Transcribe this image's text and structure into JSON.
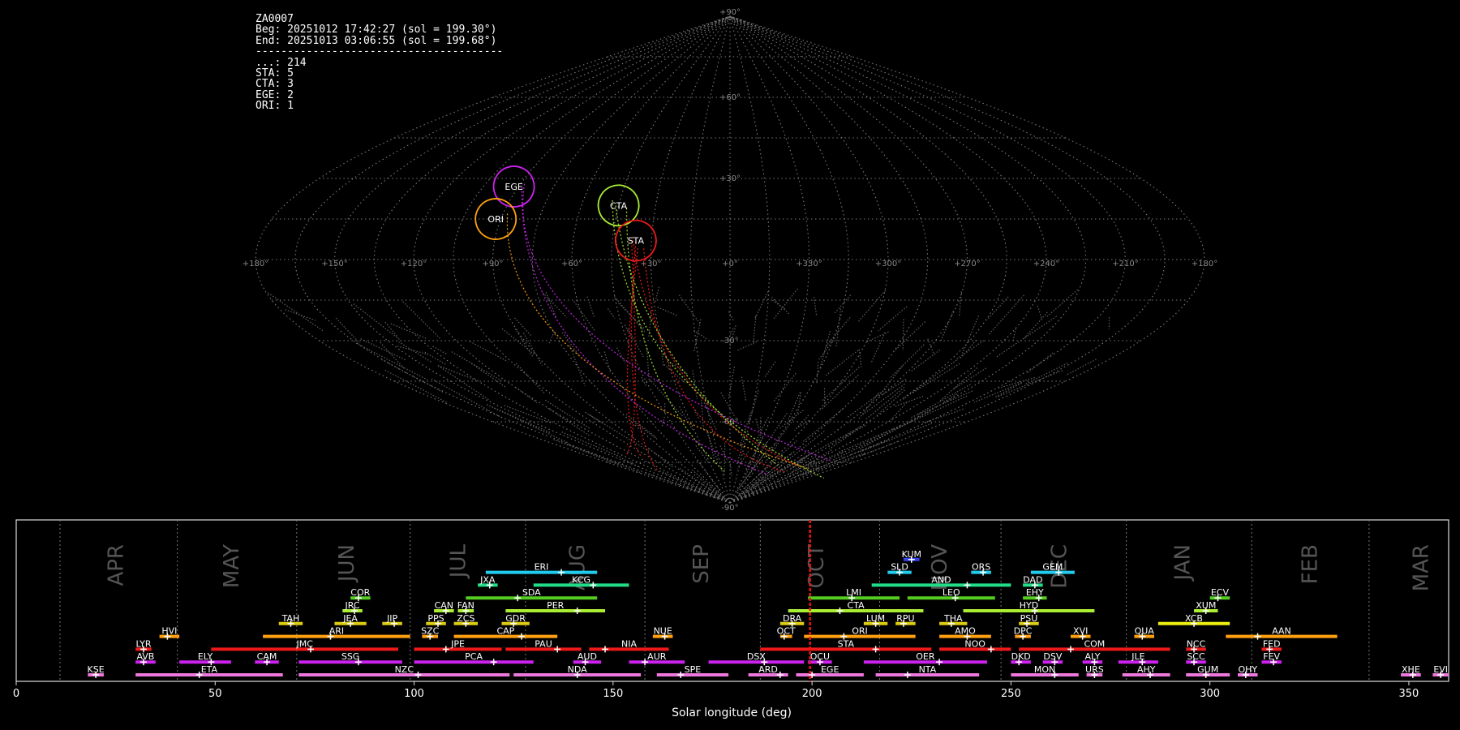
{
  "header": {
    "lines": [
      "ZA0007",
      "Beg: 20251012 17:42:27 (sol = 199.30°)",
      "End: 20251013 03:06:55 (sol = 199.68°)",
      "---------------------------------------",
      "...: 214",
      "STA: 5",
      "CTA: 3",
      "EGE: 2",
      "ORI: 1"
    ]
  },
  "chart_data": [
    {
      "type": "scatter",
      "title": "",
      "projection": "sinusoidal",
      "lon_ticks": [
        180,
        150,
        120,
        90,
        60,
        30,
        0,
        330,
        300,
        270,
        240,
        210,
        180
      ],
      "lon_tick_labels": [
        "+180°",
        "+150°",
        "+120°",
        "+90°",
        "+60°",
        "+30°",
        "+0°",
        "+330°",
        "+300°",
        "+270°",
        "+240°",
        "+210°",
        "+180°"
      ],
      "lat_ticks": [
        90,
        60,
        30,
        0,
        -30,
        -60,
        -90
      ],
      "lat_tick_labels": [
        "+90°",
        "+60°",
        "+30°",
        "",
        "-30°",
        "-60°",
        "-90°"
      ],
      "grid": true,
      "radiants": [
        {
          "code": "EGE",
          "lon": 92,
          "lat": 27,
          "color": "#cc22ee"
        },
        {
          "code": "ORI",
          "lon": 92,
          "lat": 15,
          "color": "#ffa010"
        },
        {
          "code": "CTA",
          "lon": 45,
          "lat": 20,
          "color": "#aaee33"
        },
        {
          "code": "STA",
          "lon": 36,
          "lat": 7,
          "color": "#ee1a1a"
        }
      ],
      "counts": [
        {
          "code": "...",
          "count": 214,
          "color": "#888888"
        },
        {
          "code": "STA",
          "count": 5,
          "color": "#ee1a1a"
        },
        {
          "code": "CTA",
          "count": 3,
          "color": "#aaee33"
        },
        {
          "code": "EGE",
          "count": 2,
          "color": "#cc22ee"
        },
        {
          "code": "ORI",
          "count": 1,
          "color": "#ffa010"
        }
      ]
    },
    {
      "type": "bar",
      "title": "",
      "xlabel": "Solar longitude (deg)",
      "xlim": [
        0,
        360
      ],
      "x_ticks": [
        0,
        50,
        100,
        150,
        200,
        250,
        300,
        350
      ],
      "current_sol": 199.5,
      "months": [
        {
          "name": "APR",
          "start": 11,
          "label_at": 25
        },
        {
          "name": "MAY",
          "start": 40.5,
          "label_at": 54
        },
        {
          "name": "JUN",
          "start": 70.5,
          "label_at": 83
        },
        {
          "name": "JUL",
          "start": 99,
          "label_at": 111
        },
        {
          "name": "AUG",
          "start": 128,
          "label_at": 141
        },
        {
          "name": "SEP",
          "start": 158,
          "label_at": 172
        },
        {
          "name": "OCT",
          "start": 187,
          "label_at": 201
        },
        {
          "name": "NOV",
          "start": 217,
          "label_at": 232
        },
        {
          "name": "DEC",
          "start": 247.5,
          "label_at": 262
        },
        {
          "name": "JAN",
          "start": 279,
          "label_at": 293
        },
        {
          "name": "FEB",
          "start": 310.5,
          "label_at": 325
        },
        {
          "name": "MAR",
          "start": 340,
          "label_at": 353
        }
      ],
      "showers": [
        {
          "code": "KUM",
          "row": 9,
          "start": 223,
          "end": 227,
          "peak": 225,
          "color": "#3344ee"
        },
        {
          "code": "ERI",
          "row": 8,
          "start": 118,
          "end": 146,
          "peak": 137,
          "color": "#22ccee"
        },
        {
          "code": "SLD",
          "row": 8,
          "start": 219,
          "end": 225,
          "peak": 222,
          "color": "#22ccee"
        },
        {
          "code": "ORS",
          "row": 8,
          "start": 240,
          "end": 245,
          "peak": 243,
          "color": "#22ccee"
        },
        {
          "code": "GEM",
          "row": 8,
          "start": 255,
          "end": 266,
          "peak": 262,
          "color": "#22ccee"
        },
        {
          "code": "JXA",
          "row": 7,
          "start": 116,
          "end": 121,
          "peak": 119,
          "color": "#22dd88"
        },
        {
          "code": "KCG",
          "row": 7,
          "start": 130,
          "end": 154,
          "peak": 145,
          "color": "#22dd88"
        },
        {
          "code": "AND",
          "row": 7,
          "start": 215,
          "end": 250,
          "peak": 239,
          "color": "#22dd88"
        },
        {
          "code": "DAD",
          "row": 7,
          "start": 253,
          "end": 258,
          "peak": 256,
          "color": "#22dd88"
        },
        {
          "code": "COR",
          "row": 6,
          "start": 84,
          "end": 89,
          "peak": 86,
          "color": "#55cc22"
        },
        {
          "code": "SDA",
          "row": 6,
          "start": 113,
          "end": 146,
          "peak": 126,
          "color": "#55cc22"
        },
        {
          "code": "LMI",
          "row": 6,
          "start": 199,
          "end": 222,
          "peak": 210,
          "color": "#55cc22"
        },
        {
          "code": "LEO",
          "row": 6,
          "start": 224,
          "end": 246,
          "peak": 236,
          "color": "#55cc22"
        },
        {
          "code": "EHY",
          "row": 6,
          "start": 253,
          "end": 259,
          "peak": 257,
          "color": "#55cc22"
        },
        {
          "code": "ECV",
          "row": 6,
          "start": 300,
          "end": 305,
          "peak": 302,
          "color": "#55cc22"
        },
        {
          "code": "JRC",
          "row": 5,
          "start": 82,
          "end": 87,
          "peak": 85,
          "color": "#aaee33"
        },
        {
          "code": "CAN",
          "row": 5,
          "start": 105,
          "end": 110,
          "peak": 108,
          "color": "#aaee33"
        },
        {
          "code": "FAN",
          "row": 5,
          "start": 111,
          "end": 115,
          "peak": 113,
          "color": "#aaee33"
        },
        {
          "code": "PER",
          "row": 5,
          "start": 123,
          "end": 148,
          "peak": 141,
          "color": "#aaee33"
        },
        {
          "code": "CTA",
          "row": 5,
          "start": 194,
          "end": 228,
          "peak": 207,
          "color": "#aaee33"
        },
        {
          "code": "HYD",
          "row": 5,
          "start": 238,
          "end": 271,
          "peak": 256,
          "color": "#aaee33"
        },
        {
          "code": "XUM",
          "row": 5,
          "start": 296,
          "end": 302,
          "peak": 299,
          "color": "#aaee33"
        },
        {
          "code": "TAH",
          "row": 4,
          "start": 66,
          "end": 72,
          "peak": 69,
          "color": "#ddcc11"
        },
        {
          "code": "JEA",
          "row": 4,
          "start": 80,
          "end": 88,
          "peak": 84,
          "color": "#ddcc11"
        },
        {
          "code": "JIP",
          "row": 4,
          "start": 92,
          "end": 97,
          "peak": 95,
          "color": "#ddcc11"
        },
        {
          "code": "PPS",
          "row": 4,
          "start": 103,
          "end": 108,
          "peak": 106,
          "color": "#ddcc11"
        },
        {
          "code": "ZCS",
          "row": 4,
          "start": 110,
          "end": 116,
          "peak": 113,
          "color": "#ddcc11"
        },
        {
          "code": "GDR",
          "row": 4,
          "start": 122,
          "end": 129,
          "peak": 125,
          "color": "#ddcc11"
        },
        {
          "code": "DRA",
          "row": 4,
          "start": 192,
          "end": 198,
          "peak": 195,
          "color": "#ddcc11"
        },
        {
          "code": "LUM",
          "row": 4,
          "start": 213,
          "end": 219,
          "peak": 216,
          "color": "#ddcc11"
        },
        {
          "code": "RPU",
          "row": 4,
          "start": 221,
          "end": 226,
          "peak": 223,
          "color": "#ddcc11"
        },
        {
          "code": "THA",
          "row": 4,
          "start": 232,
          "end": 239,
          "peak": 235,
          "color": "#ddcc11"
        },
        {
          "code": "PSU",
          "row": 4,
          "start": 252,
          "end": 257,
          "peak": 254,
          "color": "#ddcc11"
        },
        {
          "code": "XCB",
          "row": 4,
          "start": 287,
          "end": 305,
          "peak": 296,
          "color": "#eeee11"
        },
        {
          "code": "HVI",
          "row": 3,
          "start": 36,
          "end": 41,
          "peak": 38,
          "color": "#ffa010"
        },
        {
          "code": "ARI",
          "row": 3,
          "start": 62,
          "end": 99,
          "peak": 79,
          "color": "#ffa010"
        },
        {
          "code": "SZC",
          "row": 3,
          "start": 102,
          "end": 106,
          "peak": 104,
          "color": "#ffa010"
        },
        {
          "code": "CAP",
          "row": 3,
          "start": 110,
          "end": 136,
          "peak": 127,
          "color": "#ffa010"
        },
        {
          "code": "NUE",
          "row": 3,
          "start": 160,
          "end": 165,
          "peak": 163,
          "color": "#ffa010"
        },
        {
          "code": "OCT",
          "row": 3,
          "start": 192,
          "end": 195,
          "peak": 193,
          "color": "#ffa010"
        },
        {
          "code": "ORI",
          "row": 3,
          "start": 198,
          "end": 226,
          "peak": 208,
          "color": "#ffa010"
        },
        {
          "code": "AMO",
          "row": 3,
          "start": 232,
          "end": 245,
          "peak": 239,
          "color": "#ffa010"
        },
        {
          "code": "DPC",
          "row": 3,
          "start": 251,
          "end": 255,
          "peak": 253,
          "color": "#ffa010"
        },
        {
          "code": "XVI",
          "row": 3,
          "start": 265,
          "end": 270,
          "peak": 268,
          "color": "#ffa010"
        },
        {
          "code": "QUA",
          "row": 3,
          "start": 281,
          "end": 286,
          "peak": 283,
          "color": "#ffa010"
        },
        {
          "code": "AAN",
          "row": 3,
          "start": 304,
          "end": 332,
          "peak": 312,
          "color": "#ffa010"
        },
        {
          "code": "LYR",
          "row": 2,
          "start": 30,
          "end": 34,
          "peak": 32,
          "color": "#ee1a1a"
        },
        {
          "code": "JMC",
          "row": 2,
          "start": 49,
          "end": 96,
          "peak": 74,
          "color": "#ee1a1a"
        },
        {
          "code": "JPE",
          "row": 2,
          "start": 100,
          "end": 122,
          "peak": 108,
          "color": "#ee1a1a"
        },
        {
          "code": "PAU",
          "row": 2,
          "start": 123,
          "end": 142,
          "peak": 136,
          "color": "#ee1a1a"
        },
        {
          "code": "NIA",
          "row": 2,
          "start": 144,
          "end": 164,
          "peak": 148,
          "color": "#ee1a1a"
        },
        {
          "code": "STA",
          "row": 2,
          "start": 187,
          "end": 230,
          "peak": 216,
          "color": "#ee1a1a"
        },
        {
          "code": "NOO",
          "row": 2,
          "start": 232,
          "end": 250,
          "peak": 245,
          "color": "#ee1a1a"
        },
        {
          "code": "COM",
          "row": 2,
          "start": 252,
          "end": 290,
          "peak": 265,
          "color": "#ee1a1a"
        },
        {
          "code": "NCC",
          "row": 2,
          "start": 294,
          "end": 299,
          "peak": 296,
          "color": "#ee1a1a"
        },
        {
          "code": "FED",
          "row": 2,
          "start": 313,
          "end": 318,
          "peak": 315,
          "color": "#ee1a1a"
        },
        {
          "code": "AVB",
          "row": 1,
          "start": 30,
          "end": 35,
          "peak": 32,
          "color": "#cc22ee"
        },
        {
          "code": "ELY",
          "row": 1,
          "start": 41,
          "end": 54,
          "peak": 49,
          "color": "#cc22ee"
        },
        {
          "code": "CAM",
          "row": 1,
          "start": 60,
          "end": 66,
          "peak": 63,
          "color": "#cc22ee"
        },
        {
          "code": "SSG",
          "row": 1,
          "start": 71,
          "end": 97,
          "peak": 86,
          "color": "#cc22ee"
        },
        {
          "code": "PCA",
          "row": 1,
          "start": 100,
          "end": 130,
          "peak": 120,
          "color": "#cc22ee"
        },
        {
          "code": "AUD",
          "row": 1,
          "start": 140,
          "end": 147,
          "peak": 143,
          "color": "#cc22ee"
        },
        {
          "code": "AUR",
          "row": 1,
          "start": 154,
          "end": 168,
          "peak": 158,
          "color": "#cc22ee"
        },
        {
          "code": "DSX",
          "row": 1,
          "start": 174,
          "end": 198,
          "peak": 188,
          "color": "#cc22ee"
        },
        {
          "code": "OCU",
          "row": 1,
          "start": 199,
          "end": 205,
          "peak": 202,
          "color": "#cc22ee"
        },
        {
          "code": "OER",
          "row": 1,
          "start": 213,
          "end": 244,
          "peak": 232,
          "color": "#cc22ee"
        },
        {
          "code": "DKD",
          "row": 1,
          "start": 250,
          "end": 255,
          "peak": 252,
          "color": "#cc22ee"
        },
        {
          "code": "DSV",
          "row": 1,
          "start": 258,
          "end": 263,
          "peak": 261,
          "color": "#cc22ee"
        },
        {
          "code": "ALY",
          "row": 1,
          "start": 268,
          "end": 273,
          "peak": 271,
          "color": "#cc22ee"
        },
        {
          "code": "JLE",
          "row": 1,
          "start": 277,
          "end": 287,
          "peak": 283,
          "color": "#cc22ee"
        },
        {
          "code": "SCC",
          "row": 1,
          "start": 294,
          "end": 299,
          "peak": 296,
          "color": "#cc22ee"
        },
        {
          "code": "FEV",
          "row": 1,
          "start": 313,
          "end": 318,
          "peak": 316,
          "color": "#cc22ee"
        },
        {
          "code": "KSE",
          "row": 0,
          "start": 18,
          "end": 22,
          "peak": 20,
          "color": "#ee77dd"
        },
        {
          "code": "ETA",
          "row": 0,
          "start": 30,
          "end": 67,
          "peak": 46,
          "color": "#ee77dd"
        },
        {
          "code": "NZC",
          "row": 0,
          "start": 71,
          "end": 124,
          "peak": 101,
          "color": "#ee77dd"
        },
        {
          "code": "NDA",
          "row": 0,
          "start": 125,
          "end": 157,
          "peak": 141,
          "color": "#ee77dd"
        },
        {
          "code": "SPE",
          "row": 0,
          "start": 161,
          "end": 179,
          "peak": 167,
          "color": "#ee77dd"
        },
        {
          "code": "ARD",
          "row": 0,
          "start": 184,
          "end": 194,
          "peak": 192,
          "color": "#ee77dd"
        },
        {
          "code": "EGE",
          "row": 0,
          "start": 196,
          "end": 213,
          "peak": 200,
          "color": "#ee77dd"
        },
        {
          "code": "NTA",
          "row": 0,
          "start": 216,
          "end": 242,
          "peak": 224,
          "color": "#ee77dd"
        },
        {
          "code": "MON",
          "row": 0,
          "start": 250,
          "end": 267,
          "peak": 261,
          "color": "#ee77dd"
        },
        {
          "code": "URS",
          "row": 0,
          "start": 269,
          "end": 273,
          "peak": 271,
          "color": "#ee77dd"
        },
        {
          "code": "AHY",
          "row": 0,
          "start": 278,
          "end": 290,
          "peak": 285,
          "color": "#ee77dd"
        },
        {
          "code": "GUM",
          "row": 0,
          "start": 294,
          "end": 305,
          "peak": 299,
          "color": "#ee77dd"
        },
        {
          "code": "OHY",
          "row": 0,
          "start": 307,
          "end": 312,
          "peak": 309,
          "color": "#ee77dd"
        },
        {
          "code": "XHE",
          "row": 0,
          "start": 348,
          "end": 353,
          "peak": 351,
          "color": "#ee77dd"
        },
        {
          "code": "EVI",
          "row": 0,
          "start": 356,
          "end": 360,
          "peak": 358,
          "color": "#ee77dd"
        }
      ]
    }
  ]
}
